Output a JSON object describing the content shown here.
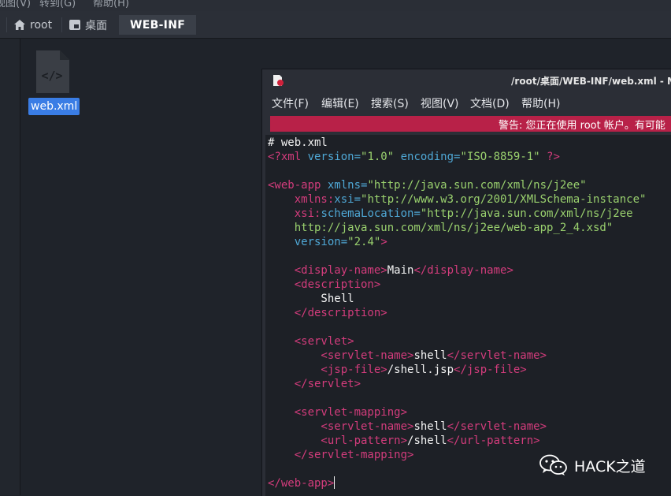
{
  "top_menu": {
    "items": [
      "视图(V)",
      "转到(G)",
      "帮助(H)"
    ]
  },
  "breadcrumb": [
    {
      "label": "root",
      "icon": "home-icon"
    },
    {
      "label": "桌面",
      "icon": "desktop-icon"
    },
    {
      "label": "WEB-INF",
      "icon": ""
    }
  ],
  "files": [
    {
      "name": "web.xml",
      "icon": "xml-file-icon",
      "selected": true
    }
  ],
  "editor": {
    "title": "/root/桌面/WEB-INF/web.xml - M",
    "menu": [
      "文件(F)",
      "编辑(E)",
      "搜索(S)",
      "视图(V)",
      "文档(D)",
      "帮助(H)"
    ],
    "warning": "警告: 您正在使用 root 帐户。有可能",
    "lines": [
      [
        [
          "# web.xml",
          "plain"
        ]
      ],
      [
        [
          "<?xml ",
          "tag"
        ],
        [
          "version=",
          "attr"
        ],
        [
          "\"1.0\"",
          "str"
        ],
        [
          " encoding=",
          "attr"
        ],
        [
          "\"ISO-8859-1\"",
          "str"
        ],
        [
          " ?>",
          "tag"
        ]
      ],
      [],
      [
        [
          "<web-app ",
          "tag"
        ],
        [
          "xmlns=",
          "attr"
        ],
        [
          "\"http://java.sun.com/xml/ns/j2ee\"",
          "str"
        ]
      ],
      [
        [
          "    xmlns:",
          "tag"
        ],
        [
          "xsi=",
          "attr"
        ],
        [
          "\"http://www.w3.org/2001/XMLSchema-instance\"",
          "str"
        ]
      ],
      [
        [
          "    xsi:",
          "tag"
        ],
        [
          "schemaLocation=",
          "attr"
        ],
        [
          "\"http://java.sun.com/xml/ns/j2ee",
          "str"
        ]
      ],
      [
        [
          "    http://java.sun.com/xml/ns/j2ee/web-app_2_4.xsd\"",
          "str"
        ]
      ],
      [
        [
          "    version=",
          "attr"
        ],
        [
          "\"2.4\"",
          "str"
        ],
        [
          ">",
          "tag"
        ]
      ],
      [],
      [
        [
          "    <display-name>",
          "tag"
        ],
        [
          "Main",
          "text"
        ],
        [
          "</display-name>",
          "tag"
        ]
      ],
      [
        [
          "    <description>",
          "tag"
        ]
      ],
      [
        [
          "        Shell",
          "text"
        ]
      ],
      [
        [
          "    </description>",
          "tag"
        ]
      ],
      [],
      [
        [
          "    <servlet>",
          "tag"
        ]
      ],
      [
        [
          "        <servlet-name>",
          "tag"
        ],
        [
          "shell",
          "text"
        ],
        [
          "</servlet-name>",
          "tag"
        ]
      ],
      [
        [
          "        <jsp-file>",
          "tag"
        ],
        [
          "/shell.jsp",
          "text"
        ],
        [
          "</jsp-file>",
          "tag"
        ]
      ],
      [
        [
          "    </servlet>",
          "tag"
        ]
      ],
      [],
      [
        [
          "    <servlet-mapping>",
          "tag"
        ]
      ],
      [
        [
          "        <servlet-name>",
          "tag"
        ],
        [
          "shell",
          "text"
        ],
        [
          "</servlet-name>",
          "tag"
        ]
      ],
      [
        [
          "        <url-pattern>",
          "tag"
        ],
        [
          "/shell",
          "text"
        ],
        [
          "</url-pattern>",
          "tag"
        ]
      ],
      [
        [
          "    </servlet-mapping>",
          "tag"
        ]
      ],
      [],
      [
        [
          "</web-app>",
          "tag"
        ]
      ]
    ]
  },
  "watermark": {
    "text": "HACK之道",
    "icon": "wechat-icon"
  },
  "colors": {
    "warning_bg": "#b82148",
    "selection": "#3a7de5",
    "syntax_tag": "#d33c7c",
    "syntax_attr": "#4fa8d6",
    "syntax_string": "#9ad16e"
  }
}
